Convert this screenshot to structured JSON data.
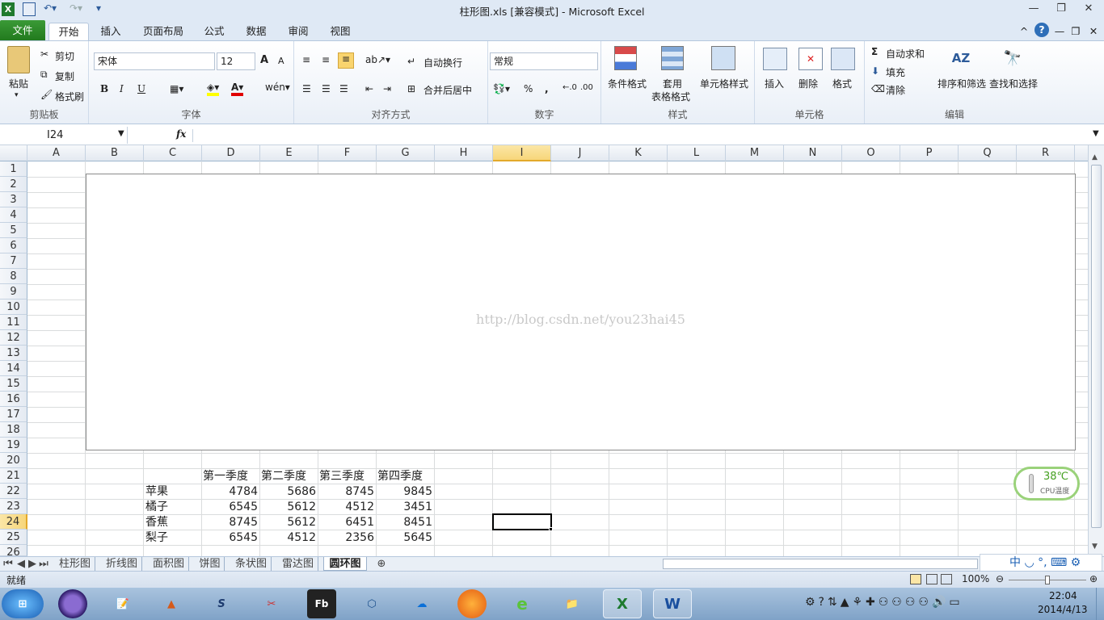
{
  "window": {
    "title": "柱形图.xls  [兼容模式]  -  Microsoft Excel",
    "min": "—",
    "restore": "❐",
    "close": "✕"
  },
  "ribbon_tabs": {
    "file": "文件",
    "home": "开始",
    "insert": "插入",
    "page_layout": "页面布局",
    "formulas": "公式",
    "data": "数据",
    "review": "审阅",
    "view": "视图"
  },
  "clipboard": {
    "paste": "粘贴",
    "cut": "剪切",
    "copy": "复制",
    "format_painter": "格式刷",
    "label": "剪贴板"
  },
  "font": {
    "name": "宋体",
    "size": "12",
    "grow": "A",
    "shrink": "A",
    "bold": "B",
    "italic": "I",
    "underline": "U",
    "label": "字体"
  },
  "alignment": {
    "wrap": "自动换行",
    "merge": "合并后居中",
    "label": "对齐方式"
  },
  "number": {
    "format": "常规",
    "percent": "%",
    "comma": ",",
    "label": "数字"
  },
  "styles": {
    "conditional": "条件格式",
    "table_fmt1": "套用",
    "table_fmt2": "表格格式",
    "cell_styles": "单元格样式",
    "label": "样式"
  },
  "cells": {
    "insert": "插入",
    "delete": "删除",
    "format": "格式",
    "label": "单元格"
  },
  "editing": {
    "autosum": "自动求和",
    "fill": "填充",
    "clear": "清除",
    "sort": "排序和筛选",
    "find": "查找和选择",
    "label": "编辑"
  },
  "formula_bar": {
    "name_box": "I24",
    "fx": "fx",
    "value": ""
  },
  "columns": [
    "A",
    "B",
    "C",
    "D",
    "E",
    "F",
    "G",
    "H",
    "I",
    "J",
    "K",
    "L",
    "M",
    "N",
    "O",
    "P",
    "Q",
    "R"
  ],
  "rows": [
    "1",
    "2",
    "3",
    "4",
    "5",
    "6",
    "7",
    "8",
    "9",
    "10",
    "11",
    "12",
    "13",
    "14",
    "15",
    "16",
    "17",
    "18",
    "19",
    "20",
    "21",
    "22",
    "23",
    "24",
    "25",
    "26"
  ],
  "chart": {
    "watermark": "http://blog.csdn.net/you23hai45"
  },
  "table": {
    "headers": [
      "第一季度",
      "第二季度",
      "第三季度",
      "第四季度"
    ],
    "rows": [
      {
        "label": "苹果",
        "values": [
          "4784",
          "5686",
          "8745",
          "9845"
        ]
      },
      {
        "label": "橘子",
        "values": [
          "6545",
          "5612",
          "4512",
          "3451"
        ]
      },
      {
        "label": "香蕉",
        "values": [
          "8745",
          "5612",
          "6451",
          "8451"
        ]
      },
      {
        "label": "梨子",
        "values": [
          "6545",
          "4512",
          "2356",
          "5645"
        ]
      }
    ]
  },
  "sheets": [
    "柱形图",
    "折线图",
    "面积图",
    "饼图",
    "条状图",
    "雷达图",
    "圆环图"
  ],
  "active_sheet": "圆环图",
  "status": {
    "ready": "就绪",
    "zoom": "100%"
  },
  "cpu_widget": {
    "temp": "38℃",
    "label": "CPU温度"
  },
  "tray": {
    "time": "22:04",
    "date": "2014/4/13",
    "ime": "中"
  },
  "taskbar_apps": [
    "Start",
    "Eclipse",
    "Notepad",
    "MATLAB",
    "Sublime",
    "Paint",
    "Flash Builder",
    "VirtualBox",
    "Cloud",
    "Firefox",
    "IE",
    "Explorer",
    "Excel",
    "Word"
  ],
  "colors": {
    "file_tab": "#2a8526",
    "active_header": "#f7d67a",
    "selection": "#000000"
  }
}
